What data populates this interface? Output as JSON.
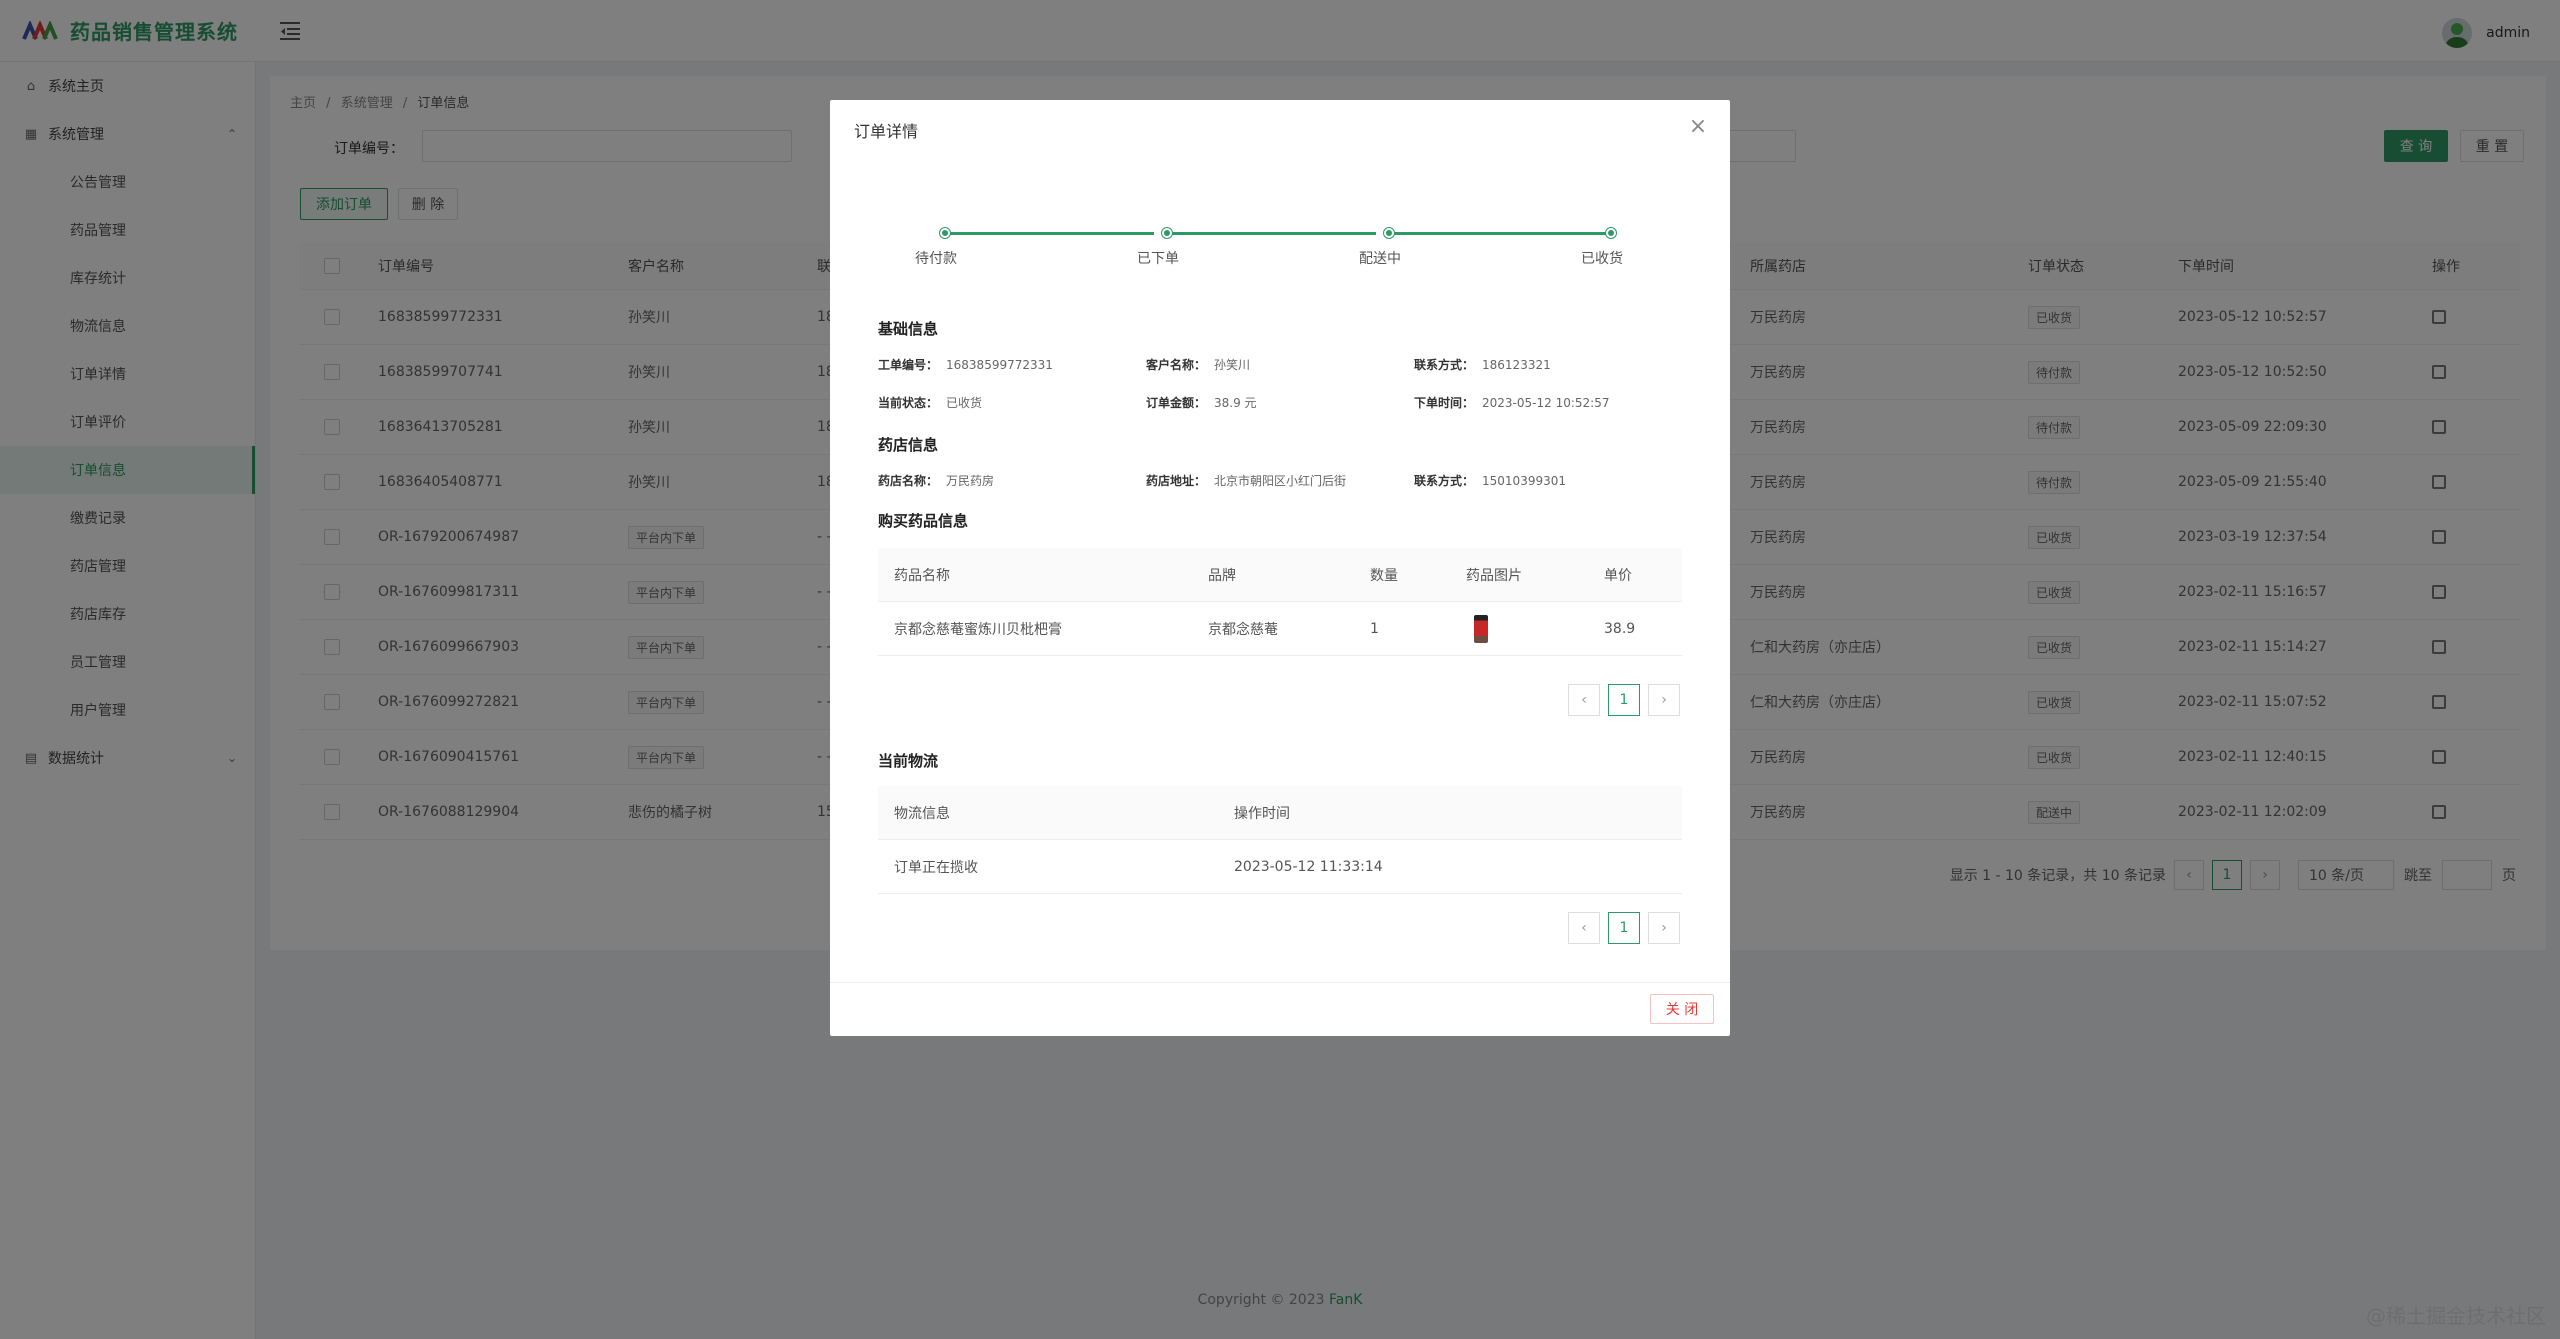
{
  "app": {
    "title": "药品销售管理系统",
    "user": "admin"
  },
  "sidebar": {
    "home": "系统主页",
    "system": "系统管理",
    "items": [
      "公告管理",
      "药品管理",
      "库存统计",
      "物流信息",
      "订单详情",
      "订单评价",
      "订单信息",
      "缴费记录",
      "药店管理",
      "药店库存",
      "员工管理",
      "用户管理"
    ],
    "stats": "数据统计"
  },
  "breadcrumb": {
    "home": "主页",
    "sep": "/",
    "section": "系统管理",
    "current": "订单信息"
  },
  "search": {
    "label": "订单编号：",
    "query_label": "查 询",
    "reset_label": "重 置"
  },
  "toolbar": {
    "add_label": "添加订单",
    "delete_label": "删 除"
  },
  "table": {
    "headers": [
      "订单编号",
      "客户名称",
      "联",
      "所属药店",
      "订单状态",
      "下单时间",
      "操作"
    ],
    "rows": [
      {
        "id": "16838599772331",
        "customer": "孙笑川",
        "contact": "18",
        "store": "万民药房",
        "status": "已收货",
        "time": "2023-05-12 10:52:57"
      },
      {
        "id": "16838599707741",
        "customer": "孙笑川",
        "contact": "18",
        "store": "万民药房",
        "status": "待付款",
        "time": "2023-05-12 10:52:50"
      },
      {
        "id": "16836413705281",
        "customer": "孙笑川",
        "contact": "18",
        "store": "万民药房",
        "status": "待付款",
        "time": "2023-05-09 22:09:30"
      },
      {
        "id": "16836405408771",
        "customer": "孙笑川",
        "contact": "18",
        "store": "万民药房",
        "status": "待付款",
        "time": "2023-05-09 21:55:40"
      },
      {
        "id": "OR-1679200674987",
        "customer": "平台内下单",
        "contact": "- -",
        "store": "万民药房",
        "status": "已收货",
        "time": "2023-03-19 12:37:54"
      },
      {
        "id": "OR-1676099817311",
        "customer": "平台内下单",
        "contact": "- -",
        "store": "万民药房",
        "status": "已收货",
        "time": "2023-02-11 15:16:57"
      },
      {
        "id": "OR-1676099667903",
        "customer": "平台内下单",
        "contact": "- -",
        "store": "仁和大药房（亦庄店）",
        "status": "已收货",
        "time": "2023-02-11 15:14:27"
      },
      {
        "id": "OR-1676099272821",
        "customer": "平台内下单",
        "contact": "- -",
        "store": "仁和大药房（亦庄店）",
        "status": "已收货",
        "time": "2023-02-11 15:07:52"
      },
      {
        "id": "OR-1676090415761",
        "customer": "平台内下单",
        "contact": "- -",
        "store": "万民药房",
        "status": "已收货",
        "time": "2023-02-11 12:40:15"
      },
      {
        "id": "OR-1676088129904",
        "customer": "悲伤的橘子树",
        "contact": "15",
        "store": "万民药房",
        "status": "配送中",
        "time": "2023-02-11 12:02:09"
      }
    ]
  },
  "pagination": {
    "summary": "显示 1 - 10 条记录，共 10 条记录",
    "page": "1",
    "page_size": "10 条/页",
    "goto": "跳至",
    "page_unit": "页"
  },
  "footer": {
    "copyright": "Copyright © 2023",
    "brand": "FanK",
    "watermark": "@稀土掘金技术社区"
  },
  "modal": {
    "title": "订单详情",
    "steps": [
      "待付款",
      "已下单",
      "配送中",
      "已收货"
    ],
    "basic": {
      "title": "基础信息",
      "order_no_label": "工单编号：",
      "order_no": "16838599772331",
      "customer_label": "客户名称：",
      "customer": "孙笑川",
      "phone_label": "联系方式：",
      "phone": "186123321",
      "status_label": "当前状态：",
      "status": "已收货",
      "amount_label": "订单金额：",
      "amount": "38.9 元",
      "time_label": "下单时间：",
      "time": "2023-05-12 10:52:57"
    },
    "store": {
      "title": "药店信息",
      "name_label": "药店名称：",
      "name": "万民药房",
      "address_label": "药店地址：",
      "address": "北京市朝阳区小红门后街",
      "phone_label": "联系方式：",
      "phone": "15010399301"
    },
    "medicines": {
      "title": "购买药品信息",
      "headers": [
        "药品名称",
        "品牌",
        "数量",
        "药品图片",
        "单价"
      ],
      "rows": [
        {
          "name": "京都念慈菴蜜炼川贝枇杷膏",
          "brand": "京都念慈菴",
          "qty": "1",
          "price": "38.9"
        }
      ],
      "page": "1"
    },
    "logistics": {
      "title": "当前物流",
      "headers": [
        "物流信息",
        "操作时间"
      ],
      "rows": [
        {
          "info": "订单正在揽收",
          "time": "2023-05-12 11:33:14"
        }
      ],
      "page": "1"
    },
    "close_label": "关 闭"
  }
}
